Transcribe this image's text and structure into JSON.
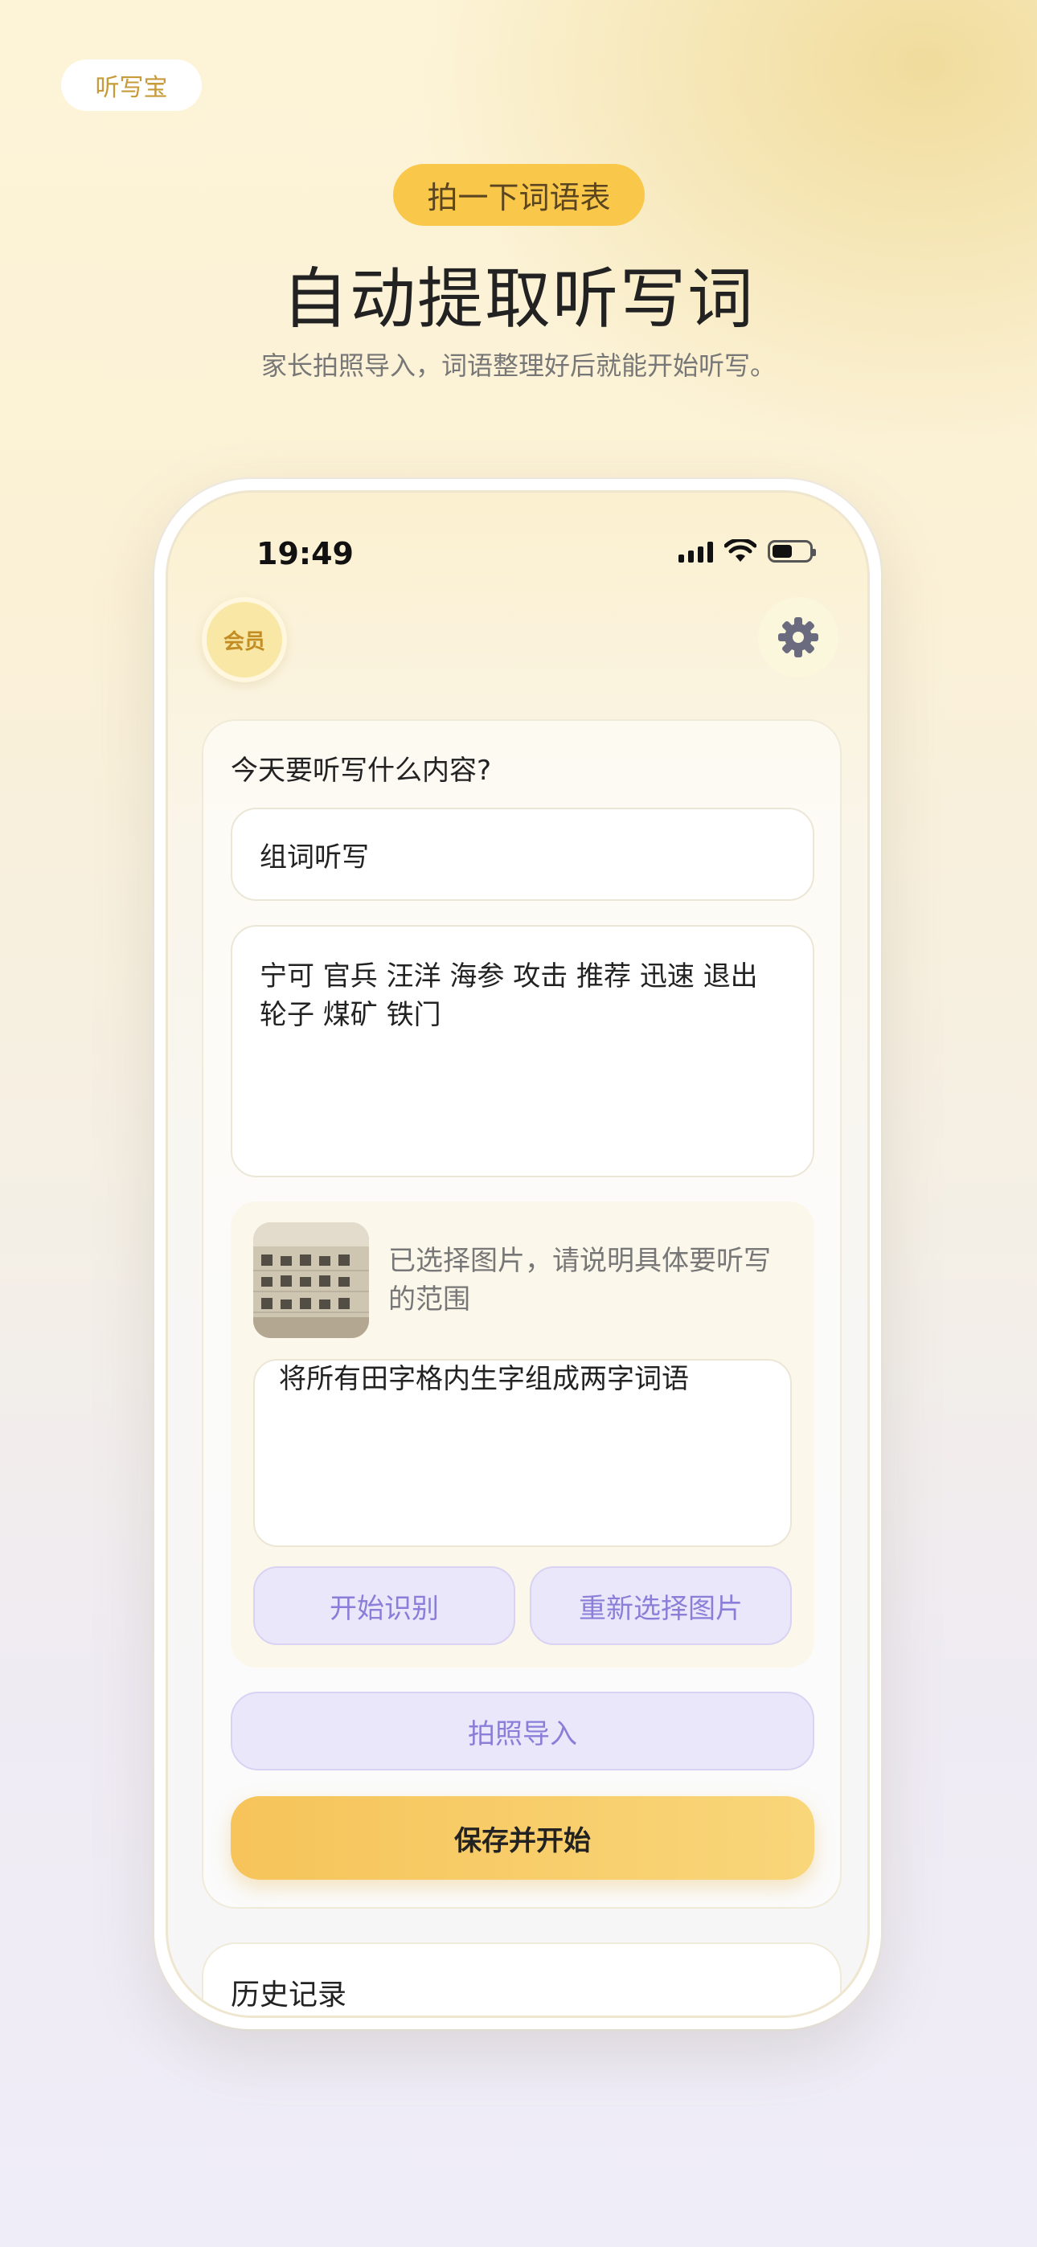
{
  "app_tag": "听写宝",
  "hero": {
    "pill": "拍一下词语表",
    "title": "自动提取听写词",
    "subtitle": "家长拍照导入，词语整理好后就能开始听写。"
  },
  "status_bar": {
    "time": "19:49",
    "icons": [
      "signal-icon",
      "wifi-icon",
      "battery-icon"
    ]
  },
  "header": {
    "member_label": "会员",
    "settings_icon": "gear-icon"
  },
  "form": {
    "question": "今天要听写什么内容?",
    "title_value": "组词听写",
    "words_value": "宁可 官兵 汪洋 海参 攻击 推荐 迅速 退出\n轮子 煤矿 铁门",
    "photo_hint": "已选择图片，请说明具体要听写的范围",
    "range_value": "将所有田字格内生字组成两字词语",
    "recognize_label": "开始识别",
    "reselect_label": "重新选择图片",
    "import_label": "拍照导入",
    "save_label": "保存并开始"
  },
  "history": {
    "title": "历史记录"
  },
  "colors": {
    "accent_yellow": "#f9c84b",
    "accent_purple": "#8a7ed8",
    "purple_bg": "#ebe7fb"
  }
}
